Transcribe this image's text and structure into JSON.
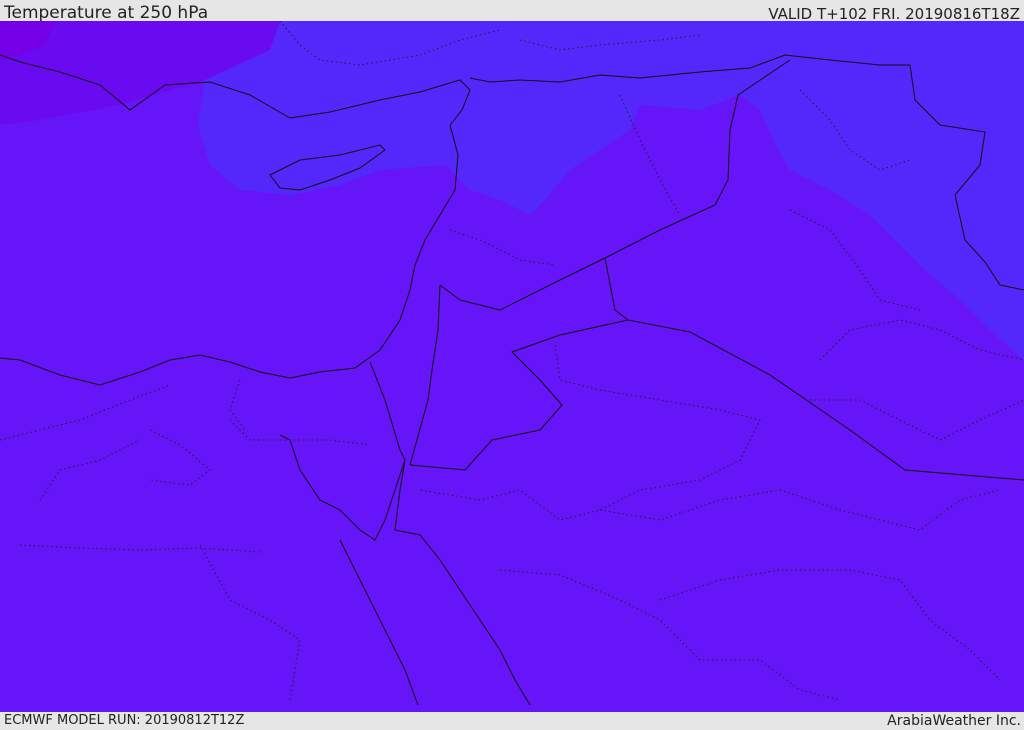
{
  "header": {
    "title": "Temperature at 250 hPa",
    "valid": "VALID T+102 FRI. 20190816T18Z"
  },
  "footer": {
    "model_run": "ECMWF MODEL RUN: 20190812T12Z",
    "credit": "ArabiaWeather Inc."
  },
  "colors": {
    "field_main": "#6615f9",
    "field_north": "#5427fb",
    "field_northwest": "#6a0af0",
    "field_corner": "#7500e8",
    "band_bg": "#e6e6e6",
    "coastline": "#111111"
  }
}
